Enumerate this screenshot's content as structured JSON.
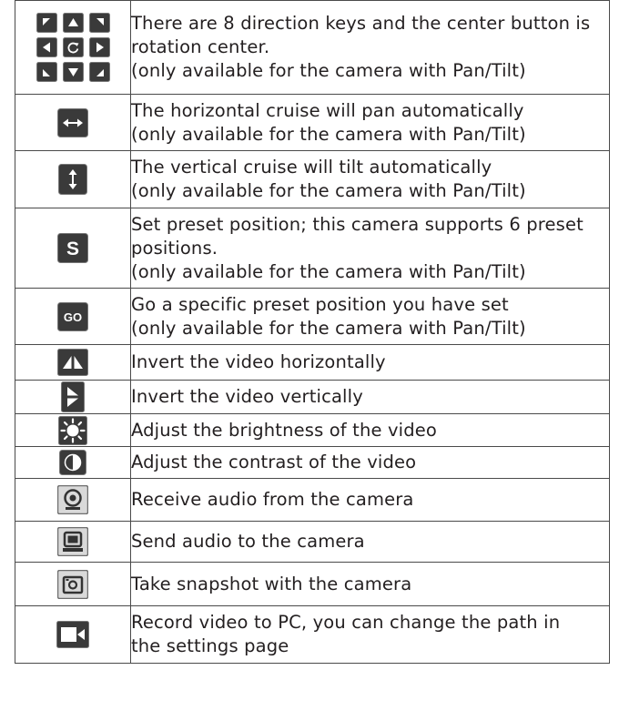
{
  "rows": [
    {
      "icon": "dpad-icon",
      "lines": [
        "There are 8 direction keys and the center button is",
        "rotation center.",
        "(only available for the camera with Pan/Tilt)"
      ]
    },
    {
      "icon": "horizontal-cruise-icon",
      "lines": [
        "The horizontal cruise will pan automatically",
        "(only available for the camera with Pan/Tilt)"
      ]
    },
    {
      "icon": "vertical-cruise-icon",
      "lines": [
        "The vertical cruise will tilt automatically",
        "(only available for the camera with Pan/Tilt)"
      ]
    },
    {
      "icon": "set-preset-icon",
      "icon_text": "S",
      "lines": [
        "Set preset position; this camera supports 6 preset",
        "positions.",
        "(only available for the camera with Pan/Tilt)"
      ]
    },
    {
      "icon": "go-preset-icon",
      "icon_text": "GO",
      "lines": [
        "Go a specific preset position you have set",
        "(only available for the camera with Pan/Tilt)"
      ]
    },
    {
      "icon": "flip-horizontal-icon",
      "lines": [
        "Invert the video horizontally"
      ]
    },
    {
      "icon": "flip-vertical-icon",
      "lines": [
        "Invert the video vertically"
      ]
    },
    {
      "icon": "brightness-icon",
      "lines": [
        "Adjust the brightness of the video"
      ]
    },
    {
      "icon": "contrast-icon",
      "lines": [
        "Adjust the contrast of the video"
      ]
    },
    {
      "icon": "receive-audio-icon",
      "lines": [
        "Receive audio from the camera"
      ]
    },
    {
      "icon": "send-audio-icon",
      "lines": [
        "Send audio to the camera"
      ]
    },
    {
      "icon": "snapshot-icon",
      "lines": [
        "Take snapshot with the camera"
      ]
    },
    {
      "icon": "record-video-icon",
      "lines": [
        "Record video to PC, you can change the path in",
        "the settings page"
      ]
    }
  ],
  "colors": {
    "icon_dark": "#3a3a3a",
    "icon_border": "#6e6e6e",
    "icon_light": "#d9d9d9",
    "text": "#231f20",
    "rule": "#4a4a4a"
  }
}
